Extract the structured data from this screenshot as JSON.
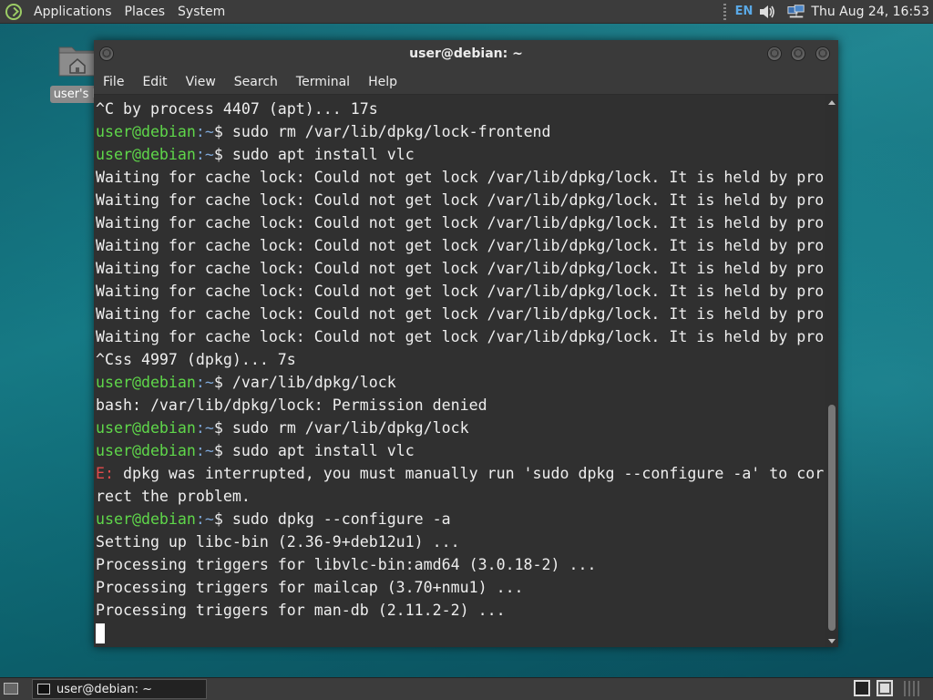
{
  "top_panel": {
    "menus": [
      "Applications",
      "Places",
      "System"
    ],
    "keyboard_layout": "EN",
    "clock": "Thu Aug 24, 16:53"
  },
  "desktop": {
    "icon_label": "user's H"
  },
  "terminal": {
    "title": "user@debian: ~",
    "menu": [
      "File",
      "Edit",
      "View",
      "Search",
      "Terminal",
      "Help"
    ],
    "prompt_user": "user@debian",
    "prompt_path": ":~",
    "prompt_symbol": "$",
    "lines": [
      {
        "kind": "out",
        "text": "^C by process 4407 (apt)... 17s"
      },
      {
        "kind": "cmd",
        "text": " sudo rm /var/lib/dpkg/lock-frontend"
      },
      {
        "kind": "cmd",
        "text": " sudo apt install vlc"
      },
      {
        "kind": "out",
        "text": "Waiting for cache lock: Could not get lock /var/lib/dpkg/lock. It is held by pro"
      },
      {
        "kind": "out",
        "text": "Waiting for cache lock: Could not get lock /var/lib/dpkg/lock. It is held by pro"
      },
      {
        "kind": "out",
        "text": "Waiting for cache lock: Could not get lock /var/lib/dpkg/lock. It is held by pro"
      },
      {
        "kind": "out",
        "text": "Waiting for cache lock: Could not get lock /var/lib/dpkg/lock. It is held by pro"
      },
      {
        "kind": "out",
        "text": "Waiting for cache lock: Could not get lock /var/lib/dpkg/lock. It is held by pro"
      },
      {
        "kind": "out",
        "text": "Waiting for cache lock: Could not get lock /var/lib/dpkg/lock. It is held by pro"
      },
      {
        "kind": "out",
        "text": "Waiting for cache lock: Could not get lock /var/lib/dpkg/lock. It is held by pro"
      },
      {
        "kind": "out",
        "text": "Waiting for cache lock: Could not get lock /var/lib/dpkg/lock. It is held by pro"
      },
      {
        "kind": "out",
        "text": "^Css 4997 (dpkg)... 7s"
      },
      {
        "kind": "cmd",
        "text": " /var/lib/dpkg/lock"
      },
      {
        "kind": "out",
        "text": "bash: /var/lib/dpkg/lock: Permission denied"
      },
      {
        "kind": "cmd",
        "text": " sudo rm /var/lib/dpkg/lock"
      },
      {
        "kind": "cmd",
        "text": " sudo apt install vlc"
      },
      {
        "kind": "err",
        "label": "E:",
        "text": " dpkg was interrupted, you must manually run 'sudo dpkg --configure -a' to cor"
      },
      {
        "kind": "out",
        "text": "rect the problem."
      },
      {
        "kind": "cmd",
        "text": " sudo dpkg --configure -a"
      },
      {
        "kind": "out",
        "text": "Setting up libc-bin (2.36-9+deb12u1) ..."
      },
      {
        "kind": "out",
        "text": "Processing triggers for libvlc-bin:amd64 (3.0.18-2) ..."
      },
      {
        "kind": "out",
        "text": "Processing triggers for mailcap (3.70+nmu1) ..."
      },
      {
        "kind": "out",
        "text": "Processing triggers for man-db (2.11.2-2) ..."
      },
      {
        "kind": "cursor",
        "text": ""
      }
    ]
  },
  "taskbar": {
    "task_label": "user@debian: ~"
  },
  "colors": {
    "prompt_user": "#5fd74a",
    "prompt_path": "#7ea7d8",
    "error_label": "#e24b4b",
    "terminal_bg": "#303030"
  }
}
